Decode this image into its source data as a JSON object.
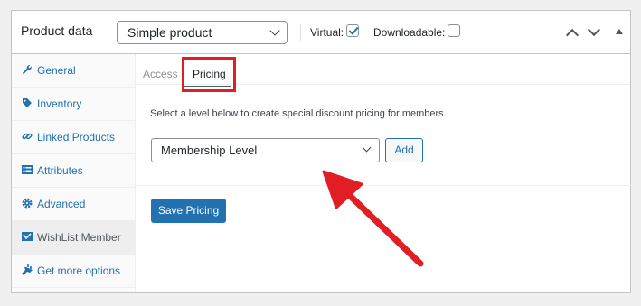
{
  "header": {
    "title": "Product data —",
    "product_type": "Simple product",
    "virtual_label": "Virtual:",
    "virtual_checked": true,
    "downloadable_label": "Downloadable:",
    "downloadable_checked": false
  },
  "sidebar": {
    "items": [
      {
        "label": "General",
        "icon": "wrench-icon",
        "active": false
      },
      {
        "label": "Inventory",
        "icon": "tag-icon",
        "active": false
      },
      {
        "label": "Linked Products",
        "icon": "link-icon",
        "active": false
      },
      {
        "label": "Attributes",
        "icon": "list-icon",
        "active": false
      },
      {
        "label": "Advanced",
        "icon": "gear-icon",
        "active": false
      },
      {
        "label": "WishList Member",
        "icon": "wishlist-member-icon",
        "active": true
      },
      {
        "label": "Get more options",
        "icon": "plugin-icon",
        "active": false
      }
    ]
  },
  "tabs": [
    {
      "label": "Access",
      "active": false
    },
    {
      "label": "Pricing",
      "active": true
    }
  ],
  "pricing": {
    "instructions": "Select a level below to create special discount pricing for members.",
    "level_select": "Membership Level",
    "add_label": "Add",
    "save_label": "Save Pricing"
  },
  "colors": {
    "accent": "#2271b1",
    "annotation": "#e01e23"
  }
}
